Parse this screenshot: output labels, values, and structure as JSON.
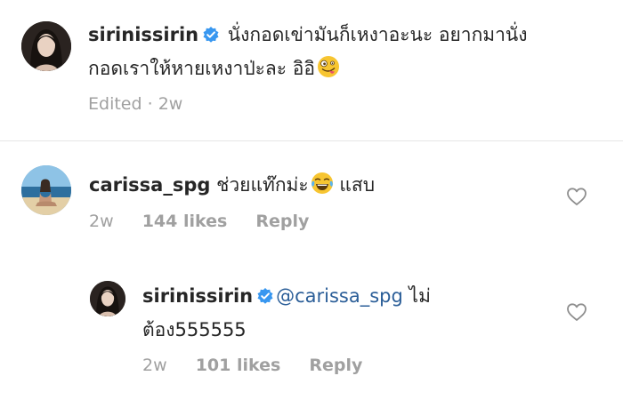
{
  "caption": {
    "username": "sirinissirin",
    "text_line1": " นั่งกอดเข่ามันก็เหงาอะนะ อยากมานั่ง",
    "text_line2": "กอดเราให้หายเหงาป่ะละ อิอิ",
    "emoji": "zany-face-emoji",
    "edited_label": "Edited",
    "time": "2w"
  },
  "comment": {
    "username": "carissa_spg",
    "text_before_emoji": " ช่วยแท๊กม่ะ",
    "emoji": "tears-of-joy-emoji",
    "text_after_emoji": " แสบ",
    "time": "2w",
    "likes": "144 likes",
    "reply_label": "Reply",
    "like_icon": "heart-outline-icon"
  },
  "reply": {
    "username": "sirinissirin",
    "mention": "@carissa_spg",
    "text_line1_rest": " ไม่",
    "text_line2": "ต้อง555555",
    "time": "2w",
    "likes": "101 likes",
    "reply_label": "Reply",
    "like_icon": "heart-outline-icon"
  },
  "colors": {
    "verified_badge": "#3897f0",
    "mention": "#2b5e98",
    "meta_text": "#a0a0a0"
  }
}
